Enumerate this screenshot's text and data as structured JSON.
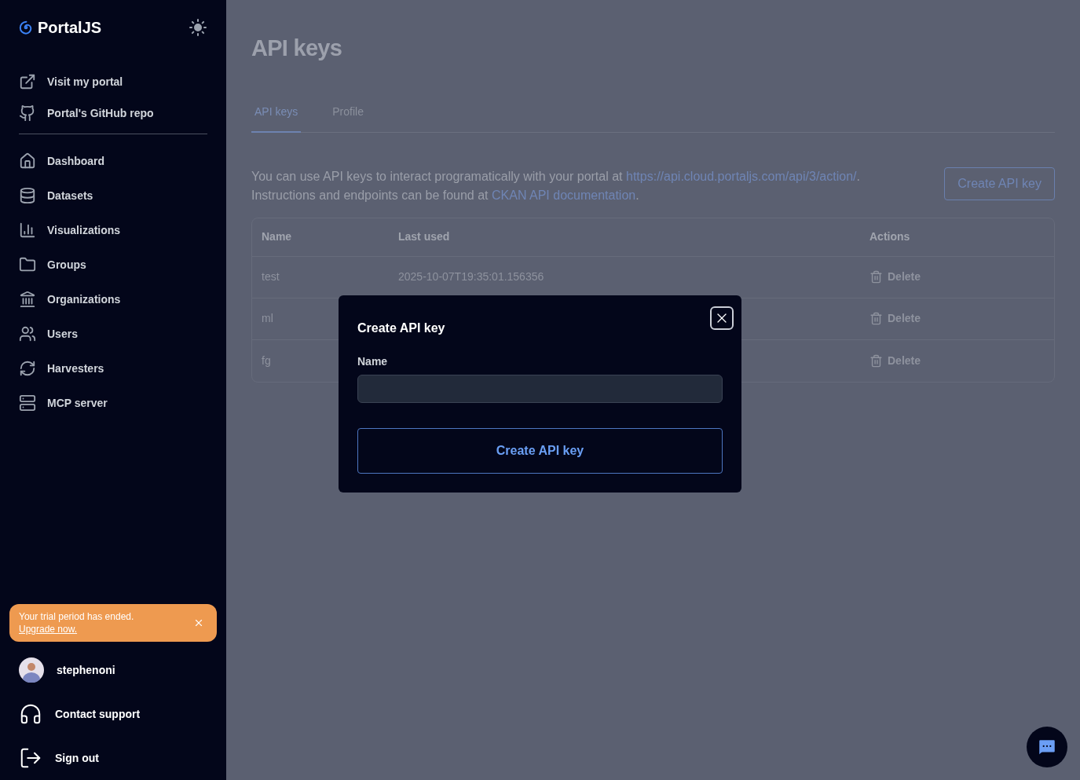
{
  "brand": "PortalJS",
  "sidebar": {
    "links": [
      {
        "label": "Visit my portal"
      },
      {
        "label": "Portal's GitHub repo"
      }
    ],
    "nav": [
      {
        "label": "Dashboard"
      },
      {
        "label": "Datasets"
      },
      {
        "label": "Visualizations"
      },
      {
        "label": "Groups"
      },
      {
        "label": "Organizations"
      },
      {
        "label": "Users"
      },
      {
        "label": "Harvesters"
      },
      {
        "label": "MCP server"
      }
    ],
    "trial_banner": {
      "text": "Your trial period has ended.",
      "link": "Upgrade now."
    },
    "user": {
      "name": "stephenoni"
    },
    "footer": [
      {
        "label": "Contact support"
      },
      {
        "label": "Sign out"
      }
    ]
  },
  "page": {
    "title": "API keys",
    "tabs": [
      {
        "label": "API keys",
        "selected": true
      },
      {
        "label": "Profile",
        "selected": false
      }
    ],
    "intro": {
      "text1": "You can use API keys to interact programatically with your portal at",
      "link1": "https://api.cloud.portaljs.com/api/3/action/",
      "end1": ".",
      "text2": "Instructions and endpoints can be found at",
      "link2": "CKAN API documentation",
      "end2": "."
    },
    "create_button": "Create API key",
    "table": {
      "columns": [
        "Name",
        "Last used",
        "Actions"
      ],
      "rows": [
        {
          "name": "test",
          "last_used": "2025-10-07T19:35:01.156356",
          "action": "Delete"
        },
        {
          "name": "ml",
          "action": "Delete"
        },
        {
          "name": "fg",
          "action": "Delete"
        }
      ]
    }
  },
  "dialog": {
    "title": "Create API key",
    "field_label": "Name",
    "submit": "Create API key"
  }
}
